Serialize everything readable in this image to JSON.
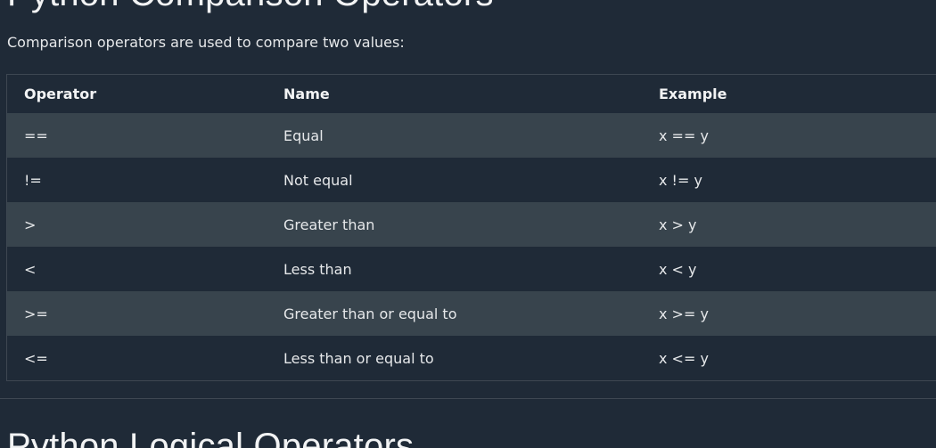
{
  "section_top": {
    "heading": "Python Comparison Operators",
    "intro": "Comparison operators are used to compare two values:"
  },
  "table": {
    "headers": [
      "Operator",
      "Name",
      "Example"
    ],
    "rows": [
      [
        "==",
        "Equal",
        "x == y"
      ],
      [
        "!=",
        "Not equal",
        "x != y"
      ],
      [
        ">",
        "Greater than",
        "x > y"
      ],
      [
        "<",
        "Less than",
        "x < y"
      ],
      [
        ">=",
        "Greater than or equal to",
        "x >= y"
      ],
      [
        "<=",
        "Less than or equal to",
        "x <= y"
      ]
    ]
  },
  "section_bottom": {
    "heading": "Python Logical Operators"
  }
}
